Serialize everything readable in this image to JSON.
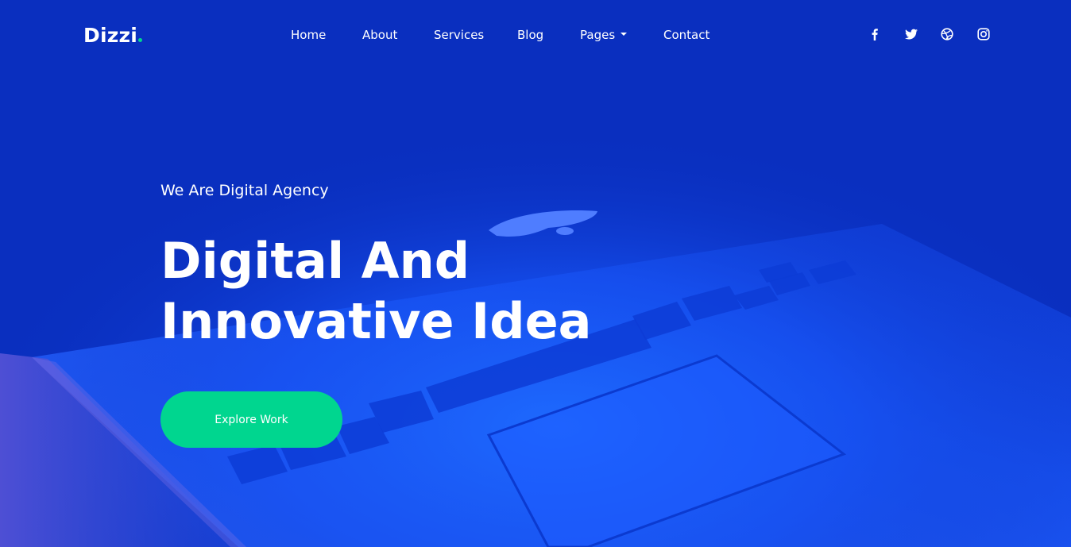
{
  "brand": {
    "name": "Dizzi",
    "accent_color": "#00d68f"
  },
  "nav": {
    "items": [
      {
        "label": "Home"
      },
      {
        "label": "About"
      },
      {
        "label": "Services"
      },
      {
        "label": "Blog"
      },
      {
        "label": "Pages",
        "has_dropdown": true
      },
      {
        "label": "Contact"
      }
    ]
  },
  "social": [
    {
      "icon": "facebook-icon"
    },
    {
      "icon": "twitter-icon"
    },
    {
      "icon": "dribbble-icon"
    },
    {
      "icon": "instagram-icon"
    }
  ],
  "hero": {
    "eyebrow": "We Are Digital Agency",
    "headline_line1": "Digital And",
    "headline_line2": "Innovative Idea",
    "cta_label": "Explore Work",
    "cta_color": "#00d68f",
    "background_color": "#0a2fbf"
  }
}
